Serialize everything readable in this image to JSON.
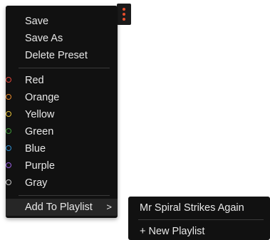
{
  "menu": {
    "actions": [
      "Save",
      "Save As",
      "Delete Preset"
    ],
    "colors": [
      {
        "label": "Red",
        "color": "#e0453a"
      },
      {
        "label": "Orange",
        "color": "#e8892b"
      },
      {
        "label": "Yellow",
        "color": "#e6c23a"
      },
      {
        "label": "Green",
        "color": "#3f9a3a"
      },
      {
        "label": "Blue",
        "color": "#2f8fd0"
      },
      {
        "label": "Purple",
        "color": "#9a5fe0"
      },
      {
        "label": "Gray",
        "color": "#c8c8c8"
      }
    ],
    "add_to_playlist": "Add To Playlist",
    "submenu_arrow": ">"
  },
  "submenu": {
    "playlist": "Mr Spiral Strikes Again",
    "new_playlist": "+ New Playlist"
  },
  "kebab_icon": "more-vertical-icon"
}
